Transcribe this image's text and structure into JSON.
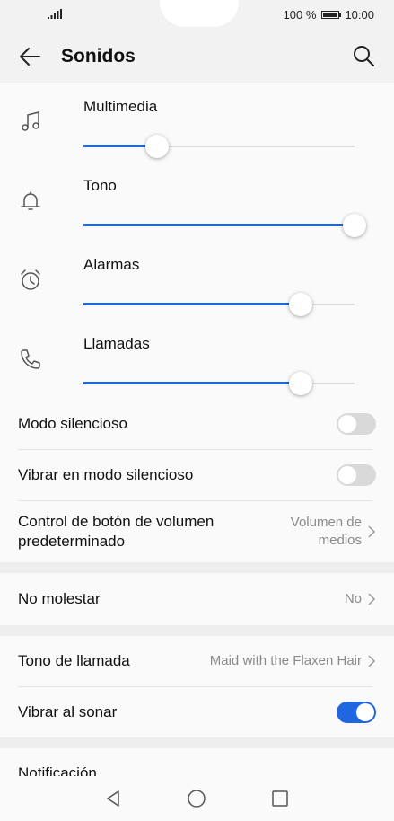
{
  "status_bar": {
    "battery_text": "100 %",
    "time": "10:00"
  },
  "header": {
    "title": "Sonidos",
    "back_icon": "back-arrow-icon",
    "search_icon": "search-icon"
  },
  "colors": {
    "accent": "#1f66e0",
    "background": "#f2f2f2"
  },
  "volumes": [
    {
      "label": "Multimedia",
      "icon": "music-note-icon",
      "level_percent": 27
    },
    {
      "label": "Tono",
      "icon": "bell-icon",
      "level_percent": 100
    },
    {
      "label": "Alarmas",
      "icon": "alarm-clock-icon",
      "level_percent": 80
    },
    {
      "label": "Llamadas",
      "icon": "phone-icon",
      "level_percent": 80
    }
  ],
  "settings": {
    "silent_mode": {
      "label": "Modo silencioso",
      "on": false
    },
    "vibrate_silent": {
      "label": "Vibrar en modo silencioso",
      "on": false
    },
    "volume_button": {
      "label_line1": "Control de botón de volumen",
      "label_line2": "predeterminado",
      "value_line1": "Volumen de",
      "value_line2": "medios"
    },
    "do_not_disturb": {
      "label": "No molestar",
      "value": "No"
    },
    "ringtone": {
      "label": "Tono de llamada",
      "value": "Maid with the Flaxen Hair"
    },
    "vibrate_ring": {
      "label": "Vibrar al sonar",
      "on": true
    },
    "notification": {
      "label": "Notificación"
    }
  }
}
